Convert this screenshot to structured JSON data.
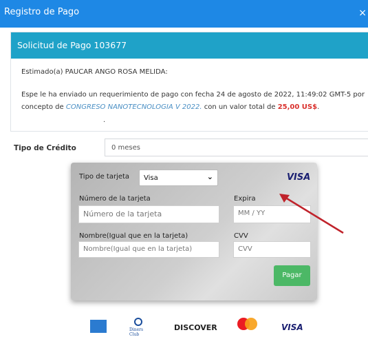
{
  "window": {
    "title": "Registro de Pago",
    "close_symbol": "×"
  },
  "request": {
    "header": "Solicitud de Pago 103677",
    "greeting": "Estimado(a) PAUCAR ANGO ROSA MELIDA:",
    "message_part1": "Espe le ha enviado un requerimiento de pago con fecha 24 de agosto de 2022, 11:49:02 GMT-5 por concepto de",
    "event_name": "CONGRESO NANOTECNOLOGIA V 2022.",
    "message_part2": "con un valor total de",
    "amount": "25,00 US$",
    "message_end": ".",
    "dot": "."
  },
  "credit": {
    "label": "Tipo de Crédito",
    "value": "0 meses"
  },
  "card_form": {
    "type_label": "Tipo de tarjeta",
    "type_value": "Visa",
    "brand_logo": "VISA",
    "number_label": "Número de la tarjeta",
    "number_placeholder": "Número de la tarjeta",
    "expiry_label": "Expira",
    "expiry_placeholder": "MM / YY",
    "name_label": "Nombre(Igual que en la tarjeta)",
    "name_placeholder": "Nombre(Igual que en la tarjeta)",
    "cvv_label": "CVV",
    "cvv_placeholder": "CVV",
    "pay_label": "Pagar"
  },
  "brands": {
    "diners_text": "Diners Club",
    "discover_text": "DISCOVER",
    "visa_text": "VISA"
  },
  "colors": {
    "title_bar": "#1e88e5",
    "header_bar": "#1fa2c8",
    "amount": "#d9302c",
    "event": "#4a8fc4",
    "pay_button": "#4cb866",
    "arrow": "#c0232b"
  }
}
